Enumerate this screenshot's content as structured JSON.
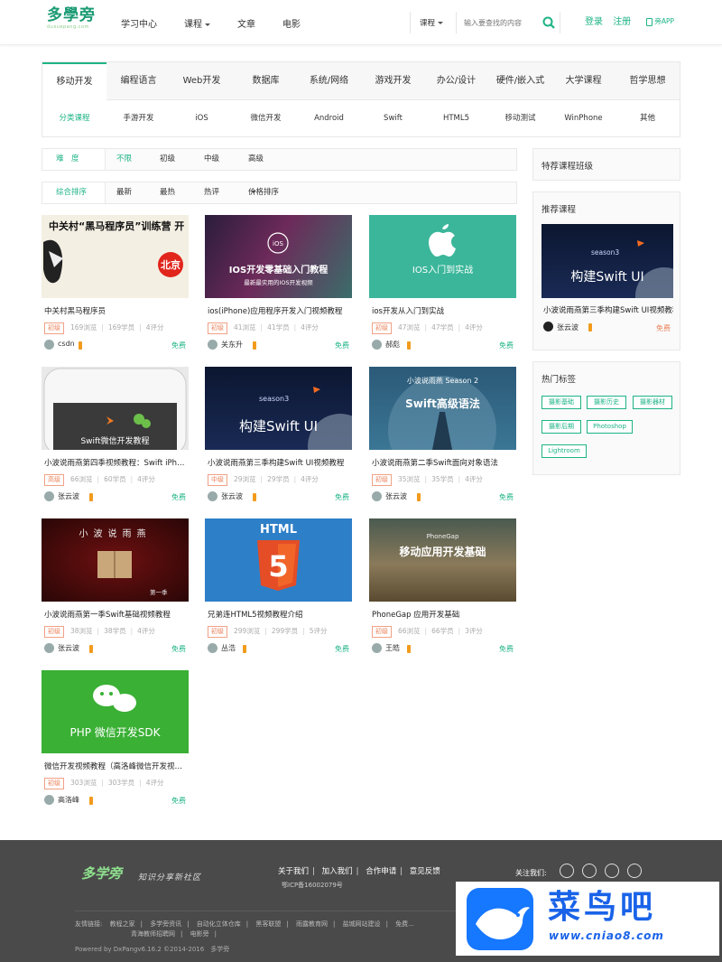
{
  "header": {
    "logo": "多學旁",
    "logo_sub": "duxuepang.com",
    "nav": [
      "学习中心",
      "课程",
      "文章",
      "电影"
    ],
    "search_select": "课程",
    "search_placeholder": "输入要查找的内容",
    "login": "登录",
    "register": "注册",
    "app": "旁APP"
  },
  "tabs": [
    "移动开发",
    "编程语言",
    "Web开发",
    "数据库",
    "系统/网络",
    "游戏开发",
    "办公/设计",
    "硬件/嵌入式",
    "大学课程",
    "哲学思想"
  ],
  "subtabs": [
    "分类课程",
    "手游开发",
    "iOS",
    "微信开发",
    "Android",
    "Swift",
    "HTML5",
    "移动测试",
    "WinPhone",
    "其他"
  ],
  "difficulty": {
    "label": "难　度",
    "options": [
      "不限",
      "初级",
      "中级",
      "高级"
    ]
  },
  "sort": {
    "options": [
      "综合排序",
      "最新",
      "最热",
      "热评",
      "价格排序"
    ]
  },
  "courses": [
    {
      "title": "中关村黑马程序员",
      "level": "初级",
      "views": "169浏览",
      "students": "169学员",
      "reviews": "4评分",
      "author": "csdn",
      "price": "免费",
      "img_text": "中关村“黑马程序员”训练营 开营啦! 北京"
    },
    {
      "title": "ios(iPhone)应用程序开发入门视频教程",
      "level": "初级",
      "views": "41浏览",
      "students": "41学员",
      "reviews": "4评分",
      "author": "关东升",
      "price": "免费",
      "img_text": "IOS开发零基础入门教程",
      "img_sub": "最新最实用的IOS开发视频"
    },
    {
      "title": "ios开发从入门到实战",
      "level": "初级",
      "views": "47浏览",
      "students": "47学员",
      "reviews": "4评分",
      "author": "郝彪",
      "price": "免费",
      "img_text": "IOS入门到实战"
    },
    {
      "title": "小波说雨燕第四季视频教程：Swift iPhone应用开发",
      "level": "高级",
      "views": "66浏览",
      "students": "60学员",
      "reviews": "4评分",
      "author": "张云波",
      "price": "免费",
      "img_text": "Swift微信开发教程"
    },
    {
      "title": "小波说雨燕第三季构建Swift UI视频教程",
      "level": "中级",
      "views": "29浏览",
      "students": "29学员",
      "reviews": "4评分",
      "author": "张云波",
      "price": "免费",
      "img_text": "构建Swift UI",
      "img_sub": "season3"
    },
    {
      "title": "小波说雨燕第二季Swift面向对象语法",
      "level": "初级",
      "views": "35浏览",
      "students": "35学员",
      "reviews": "4评分",
      "author": "张云波",
      "price": "免费",
      "img_text": "Swift高级语法",
      "img_sub": "小波说雨燕 Season 2"
    },
    {
      "title": "小波说雨燕第一季Swift基础视频教程",
      "level": "初级",
      "views": "38浏览",
      "students": "38学员",
      "reviews": "4评分",
      "author": "张云波",
      "price": "免费",
      "img_text": "小波说雨燕",
      "img_sub": "第一季"
    },
    {
      "title": "兄弟连HTML5视频教程介绍",
      "level": "初级",
      "views": "299浏览",
      "students": "299学员",
      "reviews": "5评分",
      "author": "丛浩",
      "price": "免费",
      "img_text": "HTML",
      "img_sub": "5"
    },
    {
      "title": "PhoneGap 应用开发基础",
      "level": "初级",
      "views": "66浏览",
      "students": "66学员",
      "reviews": "3评分",
      "author": "王皓",
      "price": "免费",
      "img_text": "移动应用开发基础",
      "img_sub": "PhoneGap"
    },
    {
      "title": "微信开发视频教程（高洛峰微信开发视频）",
      "level": "初级",
      "views": "303浏览",
      "students": "303学员",
      "reviews": "4评分",
      "author": "高洛峰",
      "price": "免费",
      "img_text": "PHP 微信开发SDK"
    }
  ],
  "sidebar": {
    "special_title": "特荐课程班级",
    "recommend_title": "推荐课程",
    "recommend": {
      "title": "小波说雨燕第三季构建Swift UI视频教程",
      "author": "张云波",
      "price": "免费",
      "img_text": "构建Swift UI",
      "img_sub": "season3"
    },
    "hot_title": "热门标签",
    "tags": [
      "摄影基础",
      "摄影历史",
      "摄影器材",
      "摄影后期",
      "Photoshop",
      "Lightroom"
    ]
  },
  "footer": {
    "logo": "多学旁",
    "slogan": "知识分享新社区",
    "links": [
      "关于我们",
      "加入我们",
      "合作申请",
      "意见反馈"
    ],
    "icp": "鄂ICP备16002079号",
    "follow": "关注我们:",
    "friends_label": "友情链接:",
    "friends": [
      "教程之家",
      "多学旁资讯",
      "自动化立体仓库",
      "黑客联盟",
      "雨露教育网",
      "盐城网站建设",
      "免费..."
    ],
    "friends2": [
      "青海教师招聘网",
      "电影旁"
    ],
    "copyright": "Powered by DxPangv6.16.2 ©2014-2016　多学旁"
  },
  "watermark": {
    "text": "菜鸟吧",
    "url": "www.cniao8.com"
  },
  "colors": {
    "accent": "#1db385",
    "level": "#e98058",
    "footer": "#4a4a4a",
    "wm": "#1a63e8"
  }
}
